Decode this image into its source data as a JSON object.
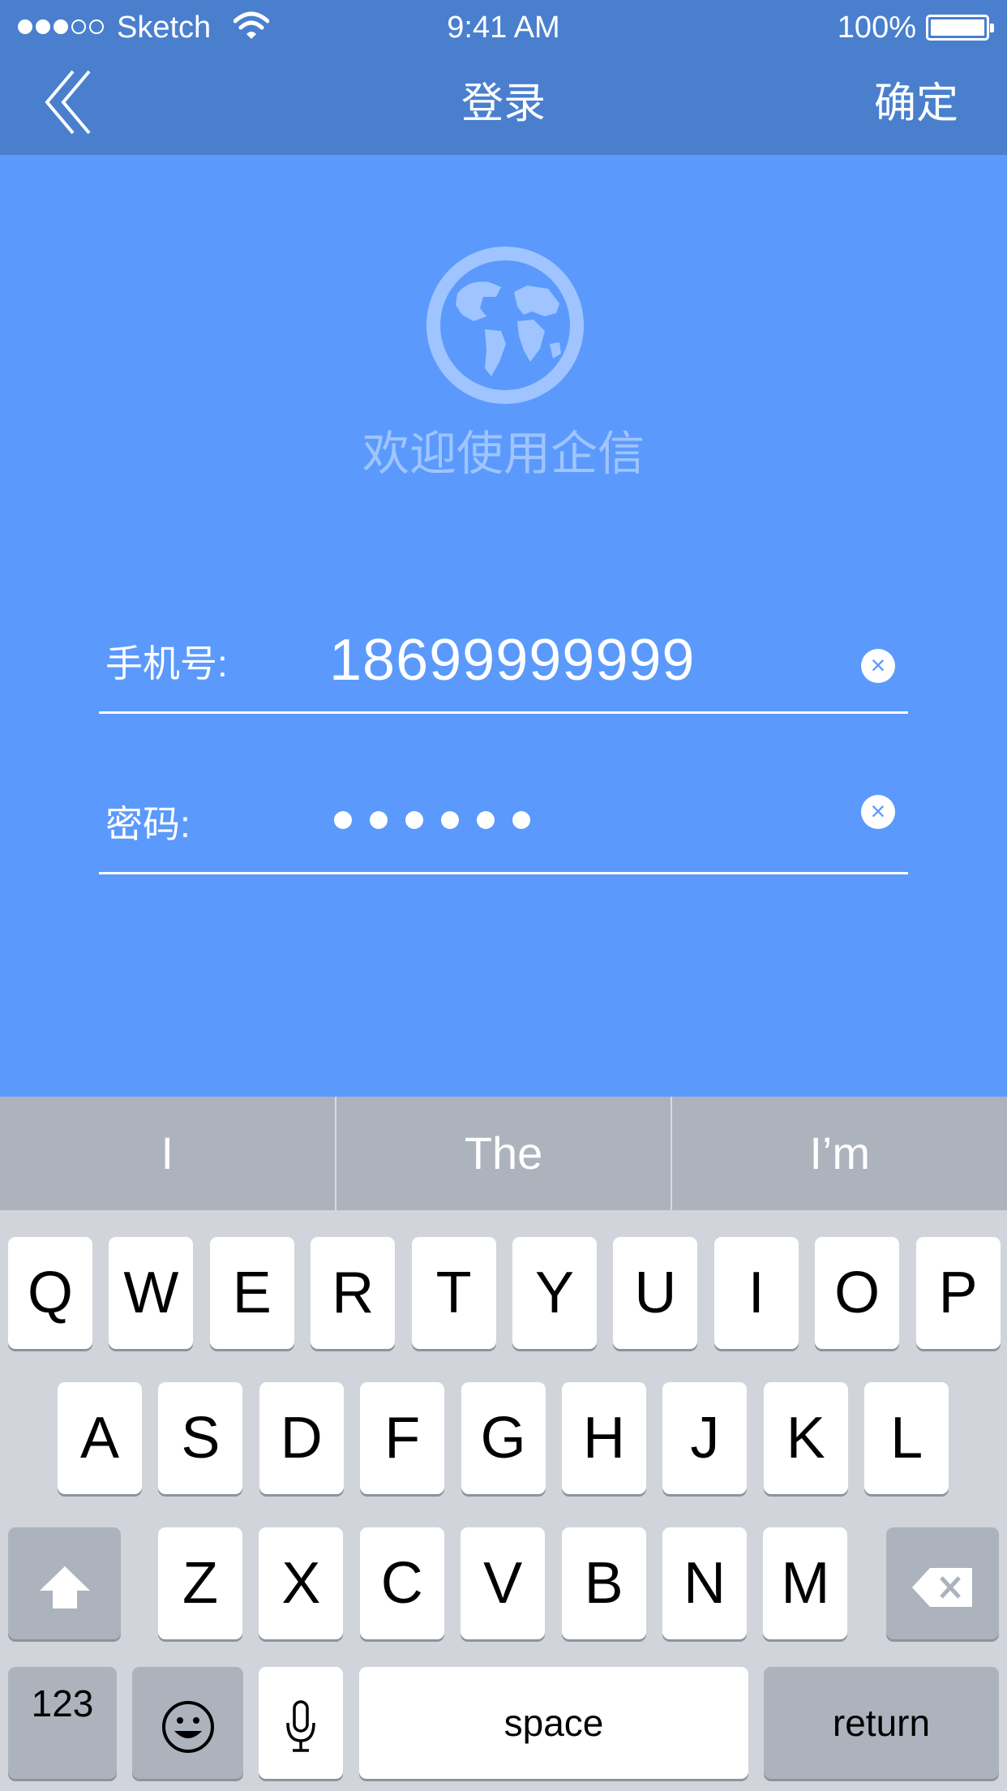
{
  "status_bar": {
    "carrier": "Sketch",
    "time": "9:41 AM",
    "battery": "100%"
  },
  "nav": {
    "title": "登录",
    "confirm_label": "确定"
  },
  "brand": {
    "welcome": "欢迎使用企信"
  },
  "form": {
    "phone_label": "手机号:",
    "phone_value": "18699999999",
    "password_label": "密码:",
    "password_length": 6
  },
  "keyboard": {
    "suggestions": [
      "I",
      "The",
      "I’m"
    ],
    "row1": [
      "Q",
      "W",
      "E",
      "R",
      "T",
      "Y",
      "U",
      "I",
      "O",
      "P"
    ],
    "row2": [
      "A",
      "S",
      "D",
      "F",
      "G",
      "H",
      "J",
      "K",
      "L"
    ],
    "row3": [
      "Z",
      "X",
      "C",
      "V",
      "B",
      "N",
      "M"
    ],
    "numbers_label": "123",
    "space_label": "space",
    "return_label": "return"
  },
  "colors": {
    "nav_bar": "#4a7fce",
    "background": "#5b9afc",
    "keyboard": "#d1d5db"
  }
}
